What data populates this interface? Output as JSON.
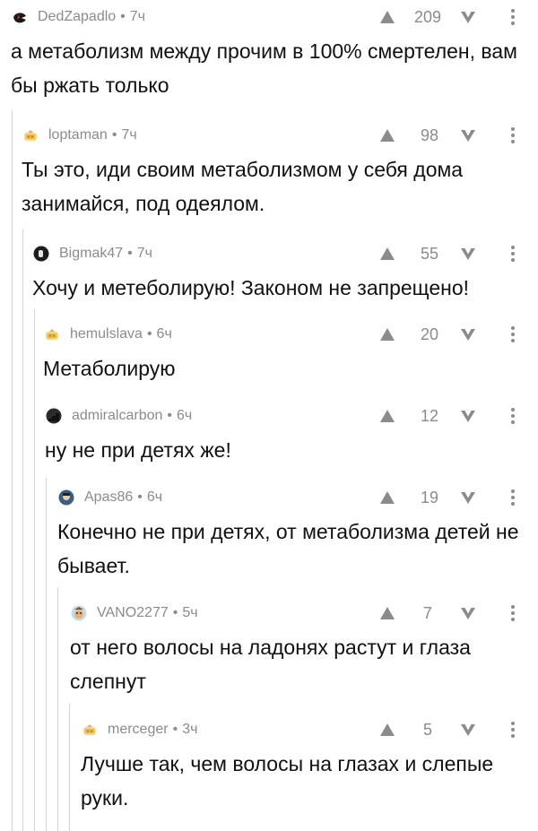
{
  "comments": [
    {
      "author": "DedZapadlo",
      "time": "7ч",
      "score": "209",
      "text": "а метаболизм между прочим в 100% смертелен, вам бы ржать только",
      "avatar": "ninja-avatar"
    },
    {
      "author": "loptaman",
      "time": "7ч",
      "score": "98",
      "text": "Ты это, иди своим метаболизмом у себя дома занимайся, под одеялом.",
      "avatar": "default-avatar"
    },
    {
      "author": "Bigmak47",
      "time": "7ч",
      "score": "55",
      "text": "Хочу и метеболирую! Законом не запрещено!",
      "avatar": "dark-avatar"
    },
    {
      "author": "hemulslava",
      "time": "6ч",
      "score": "20",
      "text": "Метаболирую",
      "avatar": "default-avatar"
    },
    {
      "author": "admiralcarbon",
      "time": "6ч",
      "score": "12",
      "text": "ну не при детях же!",
      "avatar": "stairs-avatar"
    },
    {
      "author": "Apas86",
      "time": "6ч",
      "score": "19",
      "text": "Конечно не при детях, от метаболизма детей не бывает.",
      "avatar": "face-avatar"
    },
    {
      "author": "VANO2277",
      "time": "5ч",
      "score": "7",
      "text": "от него волосы на ладонях растут и глаза слепнут",
      "avatar": "cartoon-avatar"
    },
    {
      "author": "merceger",
      "time": "3ч",
      "score": "5",
      "text": "Лучше так, чем волосы на глазах и слепые руки.",
      "avatar": "default-avatar"
    }
  ],
  "separator": "•",
  "colors": {
    "text": "#111111",
    "meta": "#8b8b8b",
    "thread_line": "#d4d4d4",
    "vote_icon": "#8b8b8b"
  },
  "icons": {
    "upvote": "upvote-triangle-icon",
    "downvote": "downvote-chevron-icon",
    "more": "more-vertical-dots-icon"
  }
}
